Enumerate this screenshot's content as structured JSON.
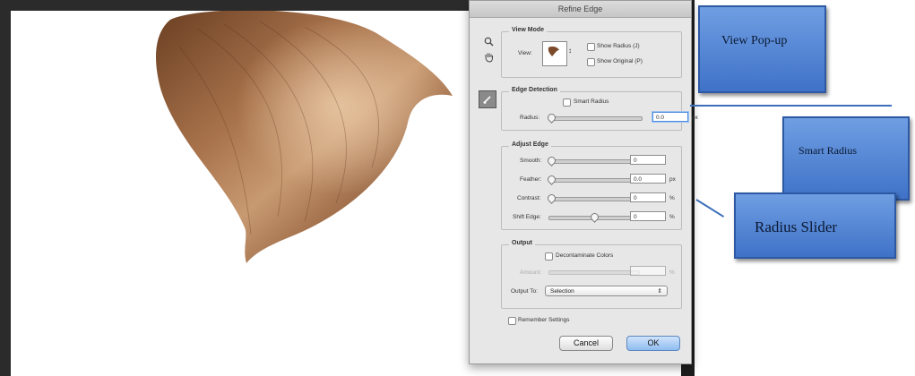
{
  "dialog": {
    "title": "Refine Edge",
    "view_mode": {
      "label": "View Mode",
      "view_label": "View:",
      "show_radius": "Show Radius (J)",
      "show_original": "Show Original (P)"
    },
    "edge_detection": {
      "label": "Edge Detection",
      "smart_radius": "Smart Radius",
      "radius_label": "Radius:",
      "radius_value": "0.0",
      "radius_unit": "px"
    },
    "adjust_edge": {
      "label": "Adjust Edge",
      "smooth_label": "Smooth:",
      "smooth_value": "0",
      "feather_label": "Feather:",
      "feather_value": "0.0",
      "feather_unit": "px",
      "contrast_label": "Contrast:",
      "contrast_value": "0",
      "contrast_unit": "%",
      "shift_label": "Shift Edge:",
      "shift_value": "0",
      "shift_unit": "%",
      "shift_level": 0.5
    },
    "output": {
      "label": "Output",
      "decontaminate": "Decontaminate Colors",
      "amount_label": "Amount:",
      "amount_unit": "%",
      "output_to_label": "Output To:",
      "output_to_value": "Selection"
    },
    "remember": "Remember Settings",
    "cancel": "Cancel",
    "ok": "OK"
  },
  "callouts": {
    "view_popup": "View Pop-up",
    "smart_radius": "Smart Radius",
    "radius_slider": "Radius Slider"
  },
  "colors": {
    "callout_fill": "#4f82d2",
    "ok_button": "#8fbcf0",
    "hair": "#8b5a36"
  }
}
